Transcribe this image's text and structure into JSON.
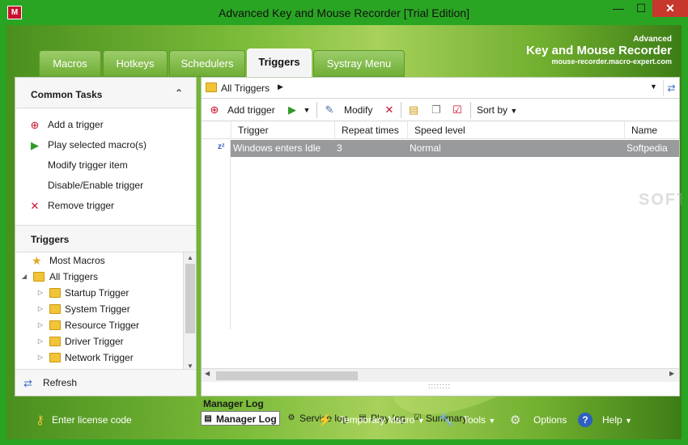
{
  "window": {
    "title": "Advanced Key and Mouse Recorder [Trial Edition]",
    "app_icon_label": "M"
  },
  "brand": {
    "line1": "Advanced",
    "line2": "Key and Mouse Recorder",
    "line3": "mouse-recorder.macro-expert.com"
  },
  "tabs": [
    {
      "label": "Macros"
    },
    {
      "label": "Hotkeys"
    },
    {
      "label": "Schedulers"
    },
    {
      "label": "Triggers"
    },
    {
      "label": "Systray Menu"
    }
  ],
  "common_tasks": {
    "title": "Common Tasks",
    "items": [
      {
        "label": "Add a trigger",
        "icon": "add-icon"
      },
      {
        "label": "Play selected macro(s)",
        "icon": "play-icon"
      },
      {
        "label": "Modify trigger item",
        "icon": ""
      },
      {
        "label": "Disable/Enable trigger",
        "icon": ""
      },
      {
        "label": "Remove trigger",
        "icon": "remove-icon"
      }
    ]
  },
  "triggers_tree": {
    "title": "Triggers",
    "items": [
      {
        "label": "Most Macros",
        "icon": "star-icon"
      },
      {
        "label": "All Triggers",
        "icon": "folder-icon"
      },
      {
        "label": "Startup Trigger",
        "icon": "folder-icon"
      },
      {
        "label": "System Trigger",
        "icon": "folder-icon"
      },
      {
        "label": "Resource Trigger",
        "icon": "folder-icon"
      },
      {
        "label": "Driver Trigger",
        "icon": "folder-icon"
      },
      {
        "label": "Network Trigger",
        "icon": "folder-icon"
      }
    ]
  },
  "refresh": {
    "label": "Refresh"
  },
  "address": {
    "path": "All Triggers"
  },
  "toolbar": {
    "add_trigger": "Add trigger",
    "modify": "Modify",
    "sort_by": "Sort by"
  },
  "grid": {
    "columns": [
      "Trigger",
      "Repeat times",
      "Speed level",
      "Name"
    ],
    "rows": [
      {
        "trigger": "Windows enters Idle",
        "repeat": "3",
        "speed": "Normal",
        "name": "Softpedia"
      }
    ]
  },
  "log": {
    "title": "Manager Log",
    "tabs": [
      {
        "label": "Manager Log"
      },
      {
        "label": "Service log"
      },
      {
        "label": "Play log"
      },
      {
        "label": "Summary"
      }
    ]
  },
  "statusbar": {
    "license": "Enter license code",
    "temporary_macro": "Temporary Macro",
    "tools": "Tools",
    "options": "Options",
    "help": "Help"
  },
  "watermark": "SOFTPEDIA"
}
